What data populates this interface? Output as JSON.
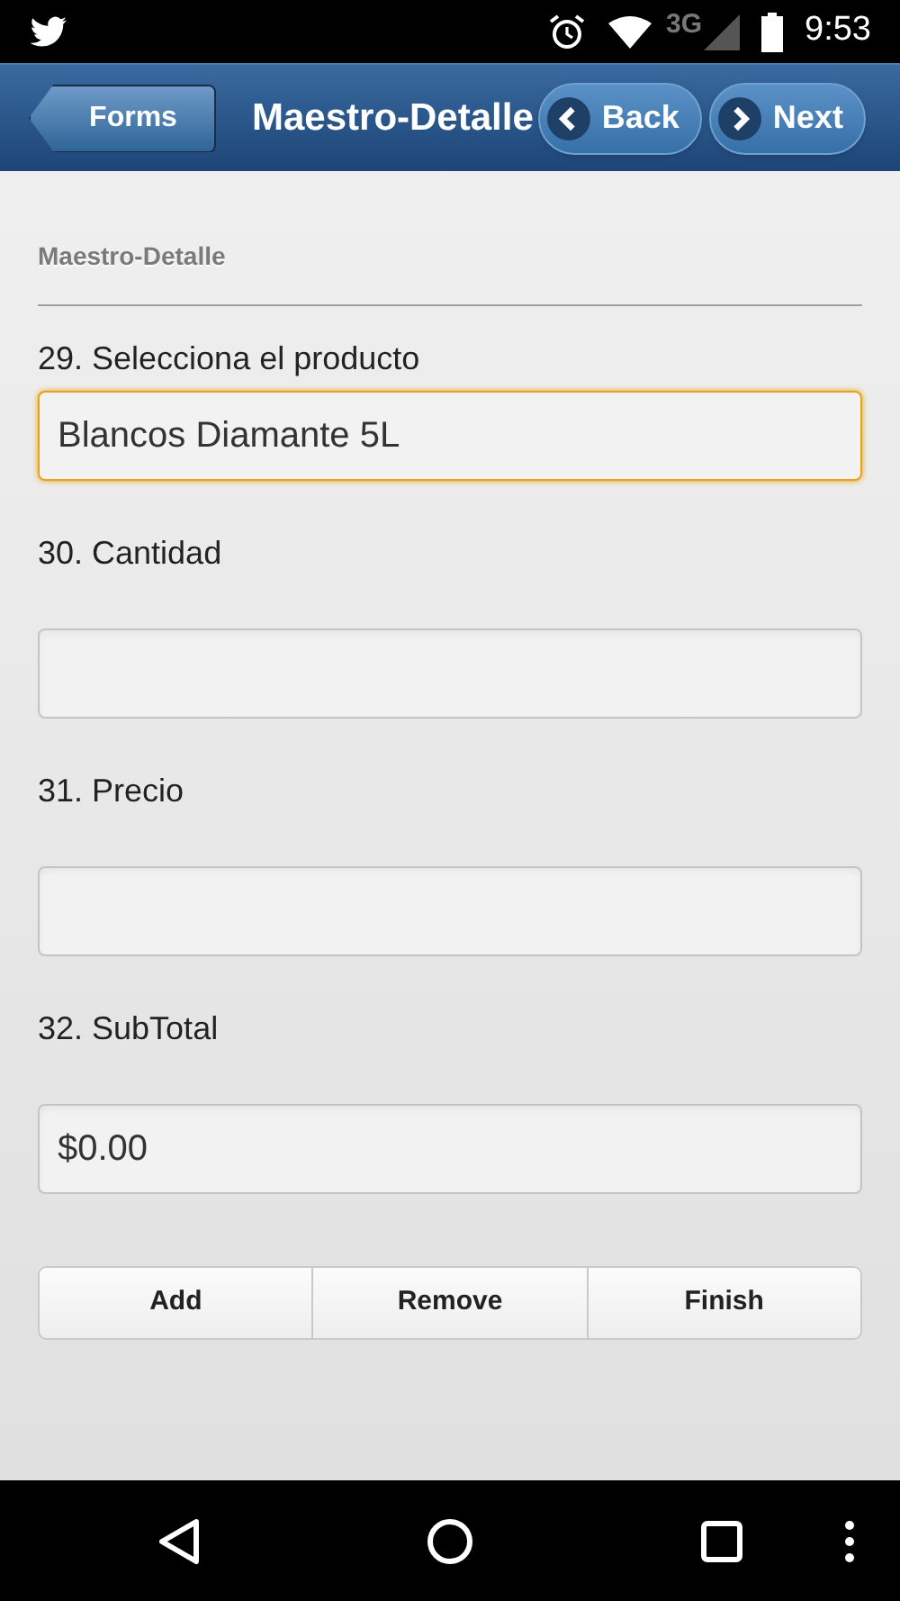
{
  "status_bar": {
    "network": "3G",
    "time": "9:53"
  },
  "header": {
    "back_link": "Forms",
    "title": "Maestro-Detalle",
    "buttons": [
      {
        "label": "Back",
        "kind": "prev"
      },
      {
        "label": "Next",
        "kind": "next"
      }
    ]
  },
  "section": {
    "title": "Maestro-Detalle"
  },
  "fields": [
    {
      "label": "29. Selecciona el producto",
      "value": "Blancos Diamante 5L",
      "focused": true
    },
    {
      "label": "30. Cantidad",
      "focused": false
    },
    {
      "label": "31. Precio",
      "focused": false
    },
    {
      "label": "32. SubTotal",
      "value": "$0.00",
      "focused": false
    }
  ],
  "actions": [
    "Add",
    "Remove",
    "Finish"
  ]
}
